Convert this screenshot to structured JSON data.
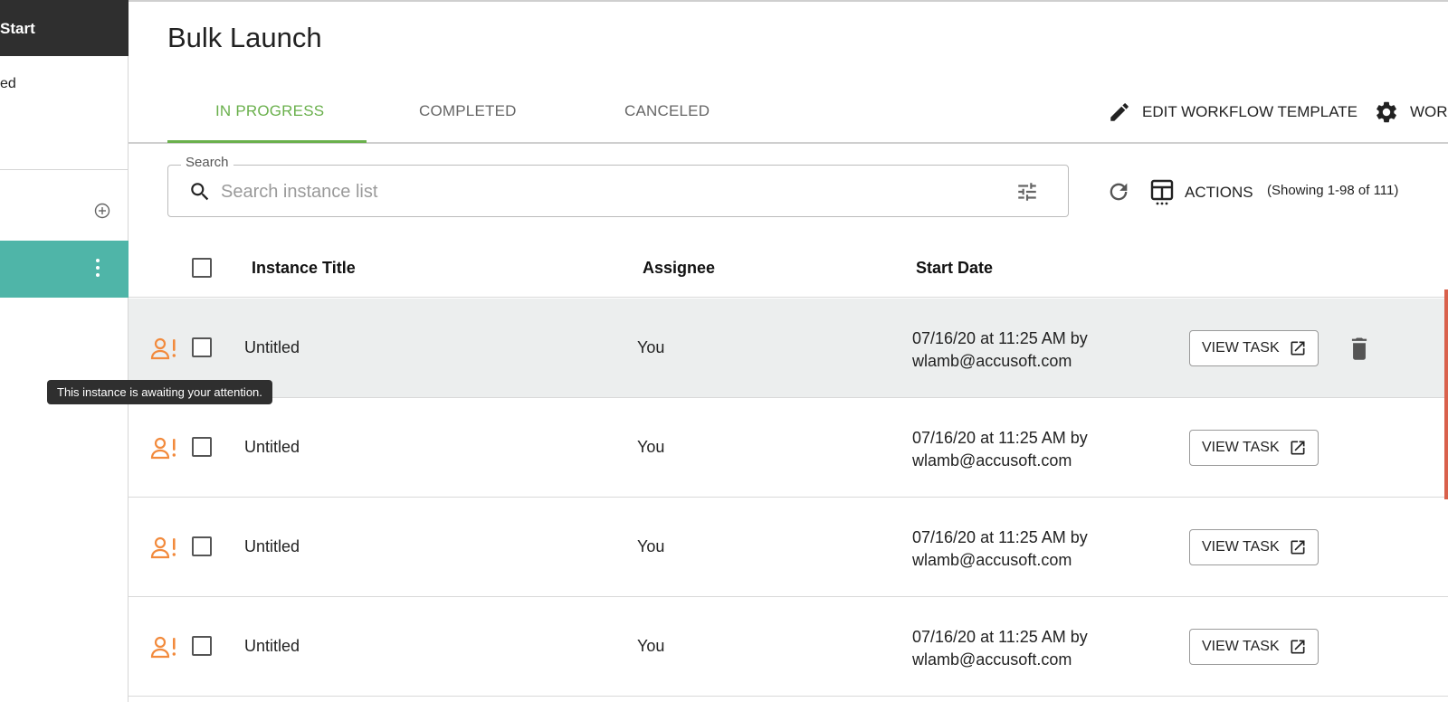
{
  "sidebar": {
    "header_label": "Start",
    "sub_label": "ed"
  },
  "page": {
    "title": "Bulk Launch"
  },
  "tabs": {
    "items": [
      {
        "label": "IN PROGRESS",
        "active": true
      },
      {
        "label": "COMPLETED",
        "active": false
      },
      {
        "label": "CANCELED",
        "active": false
      }
    ],
    "edit_template_label": "EDIT WORKFLOW TEMPLATE",
    "workflow_settings_label": "WOR"
  },
  "search": {
    "legend": "Search",
    "placeholder": "Search instance list",
    "value": ""
  },
  "toolbar": {
    "actions_label": "ACTIONS",
    "showing_text": "(Showing 1-98 of 111)"
  },
  "table": {
    "columns": [
      "Instance Title",
      "Assignee",
      "Start Date"
    ],
    "rows": [
      {
        "title": "Untitled",
        "assignee": "You",
        "date_line1": "07/16/20 at 11:25 AM by",
        "date_line2": "wlamb@accusoft.com",
        "button": "VIEW TASK"
      },
      {
        "title": "Untitled",
        "assignee": "You",
        "date_line1": "07/16/20 at 11:25 AM by",
        "date_line2": "wlamb@accusoft.com",
        "button": "VIEW TASK"
      },
      {
        "title": "Untitled",
        "assignee": "You",
        "date_line1": "07/16/20 at 11:25 AM by",
        "date_line2": "wlamb@accusoft.com",
        "button": "VIEW TASK"
      },
      {
        "title": "Untitled",
        "assignee": "You",
        "date_line1": "07/16/20 at 11:25 AM by",
        "date_line2": "wlamb@accusoft.com",
        "button": "VIEW TASK"
      }
    ]
  },
  "tooltip": {
    "text": "This instance is awaiting your attention."
  },
  "colors": {
    "accent_green": "#6ab04c",
    "sidebar_selected": "#4fb5a8",
    "alert_orange": "#f28a3c",
    "sidebar_header": "#2f2f2f"
  },
  "icons": {
    "edit": "pencil-icon",
    "settings": "gear-icon",
    "search": "search-icon",
    "filter": "tune-icon",
    "refresh": "refresh-icon",
    "actions": "table-columns-icon",
    "row_alert": "person-alert-icon",
    "row_external": "open-external-icon",
    "row_delete": "trash-icon"
  }
}
